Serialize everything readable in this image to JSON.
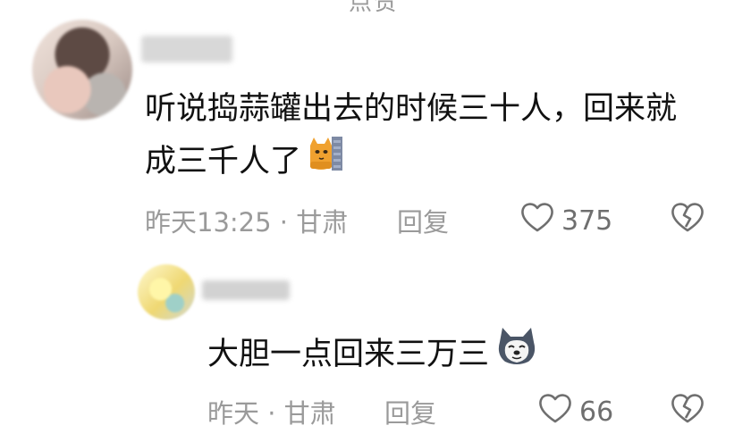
{
  "top_text": "点赞",
  "comments": [
    {
      "text_line1": "听说捣蒜罐出去的时候三十人，回来就",
      "text_line2": "成三千人了",
      "emoji": "cat-peeking-emoji",
      "meta": "昨天13:25 · 甘肃",
      "reply_label": "回复",
      "like_count": "375"
    }
  ],
  "replies": [
    {
      "text": "大胆一点回来三万三",
      "emoji": "doge-husky-emoji",
      "meta": "昨天 · 甘肃",
      "reply_label": "回复",
      "like_count": "66"
    }
  ],
  "icons": {
    "like": "heart-icon",
    "dislike": "broken-heart-icon"
  },
  "colors": {
    "meta_gray": "#9a9a9a",
    "icon_gray": "#6f6f6f"
  }
}
